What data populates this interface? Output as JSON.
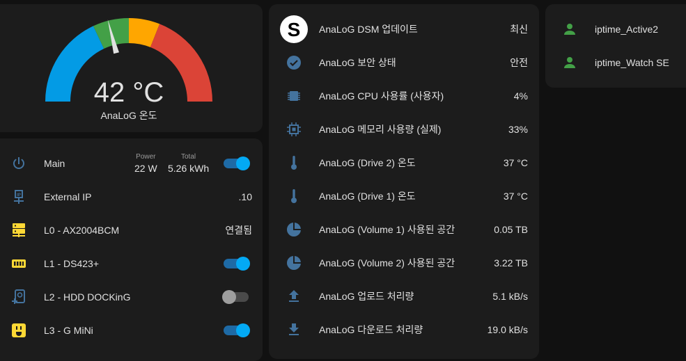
{
  "colors": {
    "accent": "#03a9f4",
    "gauge_blue": "#039be5",
    "gauge_green": "#43a047",
    "gauge_yellow": "#ffa600",
    "gauge_red": "#db4437",
    "icon_blue": "#44739e",
    "icon_yellow": "#fdd835",
    "person_green": "#43a047"
  },
  "gauge": {
    "value": "42 °C",
    "name": "AnaLoG 온도",
    "level": 42,
    "min": 0,
    "max": 100
  },
  "switches": {
    "main": {
      "icon": "power-icon",
      "label": "Main",
      "power_key": "Power",
      "power_val": "22 W",
      "total_key": "Total",
      "total_val": "5.26 kWh",
      "state": "on"
    },
    "external_ip": {
      "icon": "ip-network-icon",
      "label": "External IP",
      "value": ".10"
    },
    "l0": {
      "icon": "server-network-icon",
      "label": "L0 - AX2004BCM",
      "value": "연결됨"
    },
    "l1": {
      "icon": "nas-icon",
      "label": "L1 - DS423+",
      "state": "on"
    },
    "l2": {
      "icon": "harddisk-plus-icon",
      "label": "L2 - HDD DOCKinG",
      "state": "off"
    },
    "l3": {
      "icon": "power-socket-icon",
      "label": "L3 - G MiNi",
      "state": "on"
    }
  },
  "dsm": [
    {
      "icon": "synology-logo-icon",
      "label": "AnaLoG DSM 업데이트",
      "value": "최신"
    },
    {
      "icon": "check-circle-icon",
      "label": "AnaLoG 보안 상태",
      "value": "안전"
    },
    {
      "icon": "cpu-icon",
      "label": "AnaLoG CPU 사용률 (사용자)",
      "value": "4%"
    },
    {
      "icon": "memory-icon",
      "label": "AnaLoG 메모리 사용량 (실제)",
      "value": "33%"
    },
    {
      "icon": "thermometer-icon",
      "label": "AnaLoG (Drive 2) 온도",
      "value": "37 °C"
    },
    {
      "icon": "thermometer-icon",
      "label": "AnaLoG (Drive 1) 온도",
      "value": "37 °C"
    },
    {
      "icon": "chart-pie-icon",
      "label": "AnaLoG (Volume 1) 사용된 공간",
      "value": "0.05 TB"
    },
    {
      "icon": "chart-pie-icon",
      "label": "AnaLoG (Volume 2) 사용된 공간",
      "value": "3.22 TB"
    },
    {
      "icon": "upload-icon",
      "label": "AnaLoG 업로드 처리량",
      "value": "5.1 kB/s"
    },
    {
      "icon": "download-icon",
      "label": "AnaLoG 다운로드 처리량",
      "value": "19.0 kB/s"
    }
  ],
  "persons": [
    {
      "icon": "account-icon",
      "label": "iptime_Active2"
    },
    {
      "icon": "account-icon",
      "label": "iptime_Watch SE"
    }
  ]
}
